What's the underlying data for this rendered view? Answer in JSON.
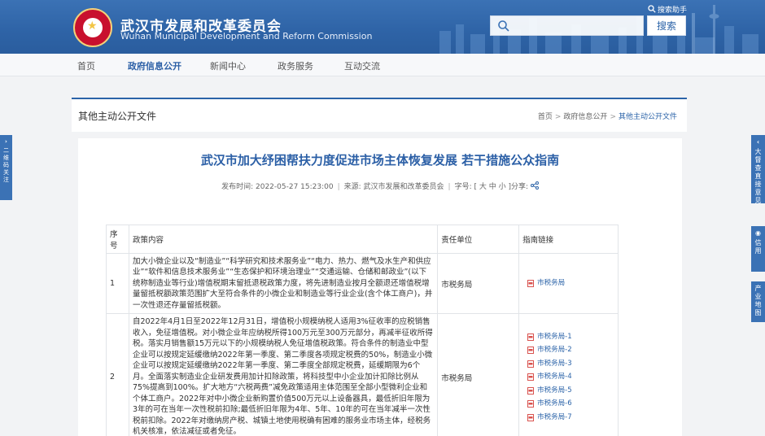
{
  "header": {
    "title": "武汉市发展和改革委员会",
    "subtitle": "Wuhan Municipal Development and Reform Commission",
    "helper_label": "搜索助手",
    "search_placeholder": "",
    "search_button": "搜索"
  },
  "nav": {
    "items": [
      "首页",
      "政府信息公开",
      "新闻中心",
      "政务服务",
      "互动交流"
    ],
    "active_index": 1
  },
  "breadcrumb": {
    "section_title": "其他主动公开文件",
    "items": [
      "首页",
      "政府信息公开",
      "其他主动公开文件"
    ]
  },
  "article": {
    "title": "武汉市加大纾困帮扶力度促进市场主体恢复发展 若干措施公众指南",
    "meta_publish": "发布时间: 2022-05-27 15:23:00",
    "meta_source": "来源: 武汉市发展和改革委员会",
    "meta_fontsize": "字号: [ 大 中 小 ]",
    "meta_share": "分享:"
  },
  "table": {
    "headers": [
      "序号",
      "政策内容",
      "责任单位",
      "指南链接"
    ],
    "rows": [
      {
        "no": "1",
        "content": "加大小微企业以及“制造业”“科学研究和技术服务业”“电力、热力、燃气及水生产和供应业”“软件和信息技术服务业”“生态保护和环境治理业”“交通运输、仓储和邮政业”(以下统称制造业等行业)增值税期末留抵退税政策力度，将先进制造业按月全额退还增值税增量留抵税额政策范围扩大至符合条件的小微企业和制造业等行业企业(含个体工商户)，并一次性退还存量留抵税额。",
        "unit": "市税务局",
        "links": [
          "市税务局"
        ]
      },
      {
        "no": "2",
        "content": "自2022年4月1日至2022年12月31日，增值税小规模纳税人适用3%征收率的应税销售收入，免征增值税。对小微企业年应纳税所得100万元至300万元部分，再减半征收所得税。落实月销售额15万元以下的小规模纳税人免征增值税政策。符合条件的制造业中型企业可以按规定延缓缴纳2022年第一季度、第二季度各项规定税费的50%，制造业小微企业可以按规定延缓缴纳2022年第一季度、第二季度全部规定税费，延缓期限为6个月。全面落实制造业企业研发费用加计扣除政策，将科技型中小企业加计扣除比例从75%提高到100%。扩大地方“六税两费”减免政策适用主体范围至全部小型微利企业和个体工商户。2022年对中小微企业新购置价值500万元以上设备器具，最低折旧年限为3年的可在当年一次性税前扣除;最低折旧年限为4年、5年、10年的可在当年减半一次性税前扣除。2022年对缴纳房产税、城镇土地使用税确有困难的服务业市场主体，经税务机关核准，依法减征或者免征。",
        "unit": "市税务局",
        "links": [
          "市税务局-1",
          "市税务局-2",
          "市税务局-3",
          "市税务局-4",
          "市税务局-5",
          "市税务局-6",
          "市税务局-7"
        ]
      }
    ]
  },
  "side": {
    "left_label": "二维码关注",
    "right_a": "大督查直接意见",
    "right_b": "信用",
    "right_c": "产业地图"
  },
  "colors": {
    "brand_blue": "#2b63a8",
    "header_blue": "#3b72b5",
    "emblem_red": "#c8102e"
  }
}
